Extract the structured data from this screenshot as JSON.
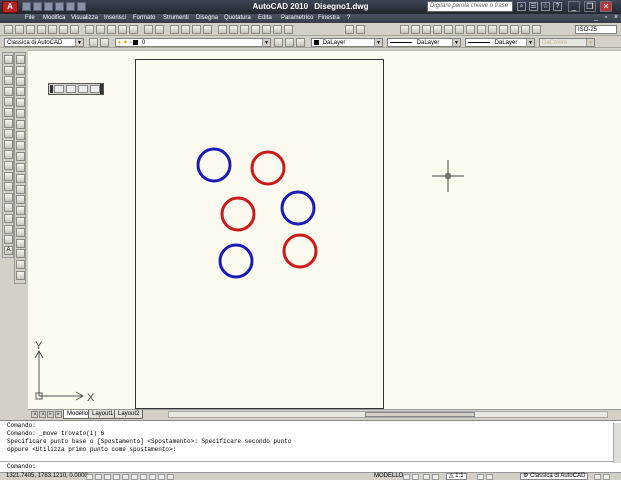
{
  "titlebar": {
    "app_name": "AutoCAD 2010",
    "document_name": "Disegno1.dwg",
    "app_button": "A",
    "search_placeholder": "Digitare parola chiave o frase",
    "window_controls": {
      "minimize": "_",
      "restore": "❐",
      "close": "✕"
    }
  },
  "menubar": {
    "items": [
      "File",
      "Modifica",
      "Visualizza",
      "Inserisci",
      "Formato",
      "Strumenti",
      "Disegna",
      "Quotatura",
      "Edita",
      "Parametrico",
      "Finestra",
      "?"
    ]
  },
  "toolbar": {
    "dimstyle_value": "ISO-25"
  },
  "properties_bar": {
    "workspace": "Classica di AutoCAD",
    "layer": "0",
    "color": "DaLayer",
    "linetype": "DaLayer",
    "lineweight": "DaLayer",
    "plotstyle": "DaColore"
  },
  "drawing": {
    "circles": [
      {
        "color": "#1a1ab8"
      },
      {
        "color": "#cc1a1a"
      },
      {
        "color": "#cc1a1a"
      },
      {
        "color": "#1a1ab8"
      },
      {
        "color": "#cc1a1a"
      },
      {
        "color": "#1a1ab8"
      }
    ],
    "ucs": {
      "x_label": "X",
      "y_label": "Y"
    },
    "background": "#fdfbef"
  },
  "layout_tabs": [
    "Modello",
    "Layout1",
    "Layout2"
  ],
  "command_window": {
    "lines": [
      "Comando:",
      "Comando: _move trovato(i) 6",
      "Specificare punto base o [Spostamento] <Spostamento>: Specificare secondo punto",
      "oppure <Utilizza primo punto come spostamento>:"
    ],
    "prompt": "Comando:"
  },
  "statusbar": {
    "coordinates": "1321.7405, 1783.1210, 0.0000",
    "model_label": "MODELLO",
    "scale": "1:1",
    "workspace": "Classica di AutoCAD"
  }
}
